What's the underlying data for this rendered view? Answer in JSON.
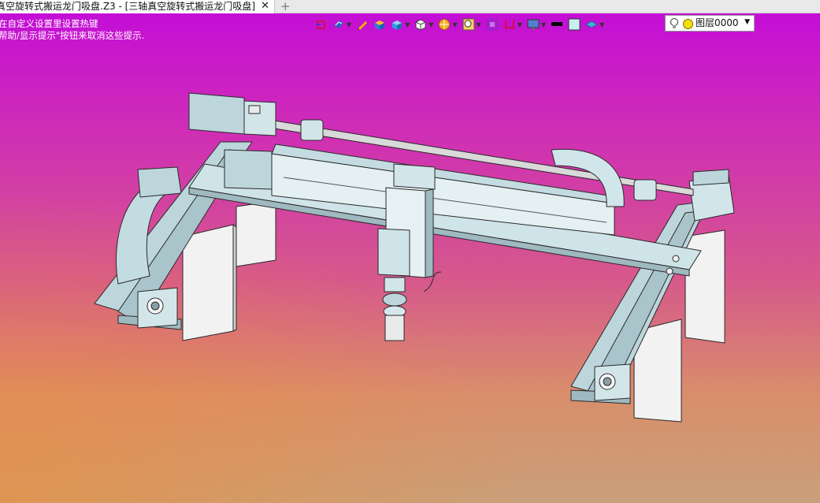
{
  "tab": {
    "title": "真空旋转式搬运龙门吸盘.Z3 - [三轴真空旋转式搬运龙门吸盘]",
    "close_glyph": "✕",
    "new_tab_glyph": "+"
  },
  "hints": [
    "在自定义设置里设置热键",
    "帮助/显示提示\"按钮来取消这些提示."
  ],
  "toolbar": {
    "items": [
      {
        "icon": "view-orient-icon"
      },
      {
        "icon": "display-mode-icon"
      },
      {
        "icon": "pencil-icon"
      },
      {
        "icon": "shaded-box-icon"
      },
      {
        "icon": "shaded-box-blue-icon"
      },
      {
        "icon": "white-cube-icon"
      },
      {
        "icon": "section-view-icon"
      },
      {
        "icon": "zoom-icon"
      },
      {
        "icon": "fit-view-icon"
      },
      {
        "icon": "dimension-icon"
      },
      {
        "icon": "monitor-icon"
      },
      {
        "icon": "line-color-icon"
      },
      {
        "icon": "fill-color-icon"
      },
      {
        "icon": "layer-plane-icon"
      }
    ],
    "line_color": "#000000",
    "fill_color": "#c8f0f4"
  },
  "layer": {
    "name": "图层0000",
    "dot_color": "#f4e000"
  },
  "colors": {
    "bg_top": "#c40ed6",
    "bg_bottom": "#c9a07a",
    "part_fill": "#bcd6dc",
    "part_stroke": "#2a2a2a",
    "leg_fill": "#f4f4f4"
  }
}
